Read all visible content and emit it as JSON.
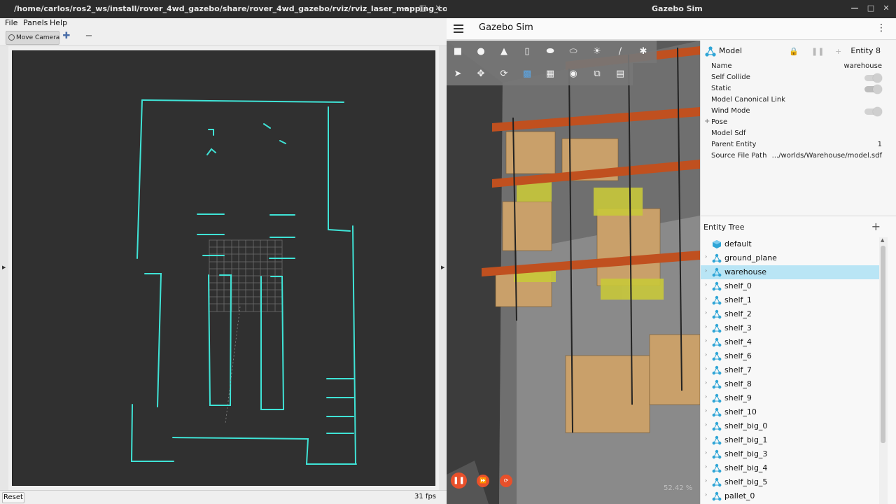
{
  "rviz": {
    "title": "/home/carlos/ros2_ws/install/rover_4wd_gazebo/share/rover_4wd_gazebo/rviz/rviz_laser_mapping_config.rviz* - RViz",
    "menu": [
      "File",
      "Panels",
      "Help"
    ],
    "toolbar": {
      "move_camera": "Move Camera"
    },
    "reset_label": "Reset",
    "fps": "31 fps"
  },
  "gazebo": {
    "window_title": "Gazebo Sim",
    "app_title": "Gazebo Sim",
    "rtf": "52.42 %",
    "component_inspector": {
      "model_label": "Model",
      "entity_label": "Entity 8",
      "rows": [
        {
          "key": "Name",
          "value": "warehouse"
        },
        {
          "key": "Self Collide",
          "value": "",
          "toggle": "off"
        },
        {
          "key": "Static",
          "value": "",
          "toggle": "on"
        },
        {
          "key": "Model Canonical Link",
          "value": ""
        },
        {
          "key": "Wind Mode",
          "value": "",
          "toggle": "off"
        },
        {
          "key": "Pose",
          "value": "",
          "expandable": true
        },
        {
          "key": "Model Sdf",
          "value": ""
        },
        {
          "key": "Parent Entity",
          "value": "1"
        },
        {
          "key": "Source File Path",
          "value": ".../worlds/Warehouse/model.sdf"
        }
      ]
    },
    "entity_tree": {
      "title": "Entity Tree",
      "items": [
        {
          "name": "default",
          "type": "world",
          "selected": false
        },
        {
          "name": "ground_plane",
          "type": "model",
          "selected": false
        },
        {
          "name": "warehouse",
          "type": "model",
          "selected": true
        },
        {
          "name": "shelf_0",
          "type": "model",
          "selected": false
        },
        {
          "name": "shelf_1",
          "type": "model",
          "selected": false
        },
        {
          "name": "shelf_2",
          "type": "model",
          "selected": false
        },
        {
          "name": "shelf_3",
          "type": "model",
          "selected": false
        },
        {
          "name": "shelf_4",
          "type": "model",
          "selected": false
        },
        {
          "name": "shelf_6",
          "type": "model",
          "selected": false
        },
        {
          "name": "shelf_7",
          "type": "model",
          "selected": false
        },
        {
          "name": "shelf_8",
          "type": "model",
          "selected": false
        },
        {
          "name": "shelf_9",
          "type": "model",
          "selected": false
        },
        {
          "name": "shelf_10",
          "type": "model",
          "selected": false
        },
        {
          "name": "shelf_big_0",
          "type": "model",
          "selected": false
        },
        {
          "name": "shelf_big_1",
          "type": "model",
          "selected": false
        },
        {
          "name": "shelf_big_3",
          "type": "model",
          "selected": false
        },
        {
          "name": "shelf_big_4",
          "type": "model",
          "selected": false
        },
        {
          "name": "shelf_big_5",
          "type": "model",
          "selected": false
        },
        {
          "name": "pallet_0",
          "type": "model",
          "selected": false
        }
      ]
    }
  },
  "colors": {
    "laser_scan": "#3fe3d6",
    "selection": "#b9e5f5",
    "play_button": "#e8502b",
    "entity_icon": "#2fa5d6"
  }
}
